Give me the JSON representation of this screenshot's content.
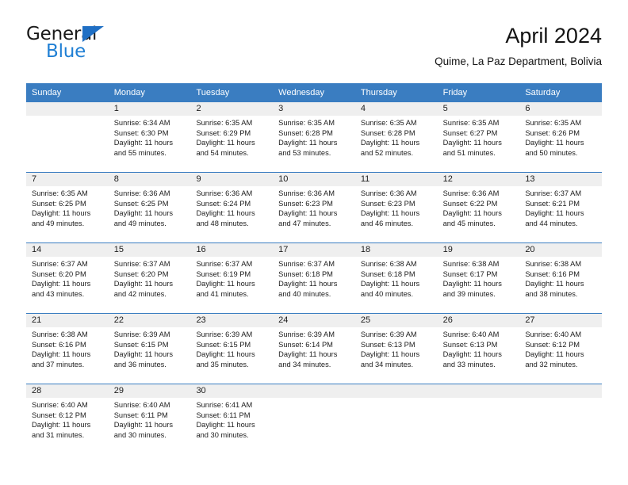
{
  "logo": {
    "word_one": "General",
    "word_two": "Blue",
    "triangle_icon": "triangle-icon",
    "brand_blue": "#1f7fd4",
    "brand_dark": "#1a1a1a"
  },
  "header": {
    "title": "April 2024",
    "subtitle": "Quime, La Paz Department, Bolivia"
  },
  "calendar": {
    "header_bg": "#3a7dc1",
    "day_band_bg": "#efefef",
    "weekdays": [
      "Sunday",
      "Monday",
      "Tuesday",
      "Wednesday",
      "Thursday",
      "Friday",
      "Saturday"
    ],
    "labels": {
      "sunrise": "Sunrise:",
      "sunset": "Sunset:",
      "daylight": "Daylight:"
    },
    "weeks": [
      [
        {
          "day": "",
          "sunrise": "",
          "sunset": "",
          "daylight_1": "",
          "daylight_2": ""
        },
        {
          "day": "1",
          "sunrise": "Sunrise: 6:34 AM",
          "sunset": "Sunset: 6:30 PM",
          "daylight_1": "Daylight: 11 hours",
          "daylight_2": "and 55 minutes."
        },
        {
          "day": "2",
          "sunrise": "Sunrise: 6:35 AM",
          "sunset": "Sunset: 6:29 PM",
          "daylight_1": "Daylight: 11 hours",
          "daylight_2": "and 54 minutes."
        },
        {
          "day": "3",
          "sunrise": "Sunrise: 6:35 AM",
          "sunset": "Sunset: 6:28 PM",
          "daylight_1": "Daylight: 11 hours",
          "daylight_2": "and 53 minutes."
        },
        {
          "day": "4",
          "sunrise": "Sunrise: 6:35 AM",
          "sunset": "Sunset: 6:28 PM",
          "daylight_1": "Daylight: 11 hours",
          "daylight_2": "and 52 minutes."
        },
        {
          "day": "5",
          "sunrise": "Sunrise: 6:35 AM",
          "sunset": "Sunset: 6:27 PM",
          "daylight_1": "Daylight: 11 hours",
          "daylight_2": "and 51 minutes."
        },
        {
          "day": "6",
          "sunrise": "Sunrise: 6:35 AM",
          "sunset": "Sunset: 6:26 PM",
          "daylight_1": "Daylight: 11 hours",
          "daylight_2": "and 50 minutes."
        }
      ],
      [
        {
          "day": "7",
          "sunrise": "Sunrise: 6:35 AM",
          "sunset": "Sunset: 6:25 PM",
          "daylight_1": "Daylight: 11 hours",
          "daylight_2": "and 49 minutes."
        },
        {
          "day": "8",
          "sunrise": "Sunrise: 6:36 AM",
          "sunset": "Sunset: 6:25 PM",
          "daylight_1": "Daylight: 11 hours",
          "daylight_2": "and 49 minutes."
        },
        {
          "day": "9",
          "sunrise": "Sunrise: 6:36 AM",
          "sunset": "Sunset: 6:24 PM",
          "daylight_1": "Daylight: 11 hours",
          "daylight_2": "and 48 minutes."
        },
        {
          "day": "10",
          "sunrise": "Sunrise: 6:36 AM",
          "sunset": "Sunset: 6:23 PM",
          "daylight_1": "Daylight: 11 hours",
          "daylight_2": "and 47 minutes."
        },
        {
          "day": "11",
          "sunrise": "Sunrise: 6:36 AM",
          "sunset": "Sunset: 6:23 PM",
          "daylight_1": "Daylight: 11 hours",
          "daylight_2": "and 46 minutes."
        },
        {
          "day": "12",
          "sunrise": "Sunrise: 6:36 AM",
          "sunset": "Sunset: 6:22 PM",
          "daylight_1": "Daylight: 11 hours",
          "daylight_2": "and 45 minutes."
        },
        {
          "day": "13",
          "sunrise": "Sunrise: 6:37 AM",
          "sunset": "Sunset: 6:21 PM",
          "daylight_1": "Daylight: 11 hours",
          "daylight_2": "and 44 minutes."
        }
      ],
      [
        {
          "day": "14",
          "sunrise": "Sunrise: 6:37 AM",
          "sunset": "Sunset: 6:20 PM",
          "daylight_1": "Daylight: 11 hours",
          "daylight_2": "and 43 minutes."
        },
        {
          "day": "15",
          "sunrise": "Sunrise: 6:37 AM",
          "sunset": "Sunset: 6:20 PM",
          "daylight_1": "Daylight: 11 hours",
          "daylight_2": "and 42 minutes."
        },
        {
          "day": "16",
          "sunrise": "Sunrise: 6:37 AM",
          "sunset": "Sunset: 6:19 PM",
          "daylight_1": "Daylight: 11 hours",
          "daylight_2": "and 41 minutes."
        },
        {
          "day": "17",
          "sunrise": "Sunrise: 6:37 AM",
          "sunset": "Sunset: 6:18 PM",
          "daylight_1": "Daylight: 11 hours",
          "daylight_2": "and 40 minutes."
        },
        {
          "day": "18",
          "sunrise": "Sunrise: 6:38 AM",
          "sunset": "Sunset: 6:18 PM",
          "daylight_1": "Daylight: 11 hours",
          "daylight_2": "and 40 minutes."
        },
        {
          "day": "19",
          "sunrise": "Sunrise: 6:38 AM",
          "sunset": "Sunset: 6:17 PM",
          "daylight_1": "Daylight: 11 hours",
          "daylight_2": "and 39 minutes."
        },
        {
          "day": "20",
          "sunrise": "Sunrise: 6:38 AM",
          "sunset": "Sunset: 6:16 PM",
          "daylight_1": "Daylight: 11 hours",
          "daylight_2": "and 38 minutes."
        }
      ],
      [
        {
          "day": "21",
          "sunrise": "Sunrise: 6:38 AM",
          "sunset": "Sunset: 6:16 PM",
          "daylight_1": "Daylight: 11 hours",
          "daylight_2": "and 37 minutes."
        },
        {
          "day": "22",
          "sunrise": "Sunrise: 6:39 AM",
          "sunset": "Sunset: 6:15 PM",
          "daylight_1": "Daylight: 11 hours",
          "daylight_2": "and 36 minutes."
        },
        {
          "day": "23",
          "sunrise": "Sunrise: 6:39 AM",
          "sunset": "Sunset: 6:15 PM",
          "daylight_1": "Daylight: 11 hours",
          "daylight_2": "and 35 minutes."
        },
        {
          "day": "24",
          "sunrise": "Sunrise: 6:39 AM",
          "sunset": "Sunset: 6:14 PM",
          "daylight_1": "Daylight: 11 hours",
          "daylight_2": "and 34 minutes."
        },
        {
          "day": "25",
          "sunrise": "Sunrise: 6:39 AM",
          "sunset": "Sunset: 6:13 PM",
          "daylight_1": "Daylight: 11 hours",
          "daylight_2": "and 34 minutes."
        },
        {
          "day": "26",
          "sunrise": "Sunrise: 6:40 AM",
          "sunset": "Sunset: 6:13 PM",
          "daylight_1": "Daylight: 11 hours",
          "daylight_2": "and 33 minutes."
        },
        {
          "day": "27",
          "sunrise": "Sunrise: 6:40 AM",
          "sunset": "Sunset: 6:12 PM",
          "daylight_1": "Daylight: 11 hours",
          "daylight_2": "and 32 minutes."
        }
      ],
      [
        {
          "day": "28",
          "sunrise": "Sunrise: 6:40 AM",
          "sunset": "Sunset: 6:12 PM",
          "daylight_1": "Daylight: 11 hours",
          "daylight_2": "and 31 minutes."
        },
        {
          "day": "29",
          "sunrise": "Sunrise: 6:40 AM",
          "sunset": "Sunset: 6:11 PM",
          "daylight_1": "Daylight: 11 hours",
          "daylight_2": "and 30 minutes."
        },
        {
          "day": "30",
          "sunrise": "Sunrise: 6:41 AM",
          "sunset": "Sunset: 6:11 PM",
          "daylight_1": "Daylight: 11 hours",
          "daylight_2": "and 30 minutes."
        },
        {
          "day": "",
          "sunrise": "",
          "sunset": "",
          "daylight_1": "",
          "daylight_2": ""
        },
        {
          "day": "",
          "sunrise": "",
          "sunset": "",
          "daylight_1": "",
          "daylight_2": ""
        },
        {
          "day": "",
          "sunrise": "",
          "sunset": "",
          "daylight_1": "",
          "daylight_2": ""
        },
        {
          "day": "",
          "sunrise": "",
          "sunset": "",
          "daylight_1": "",
          "daylight_2": ""
        }
      ]
    ]
  }
}
